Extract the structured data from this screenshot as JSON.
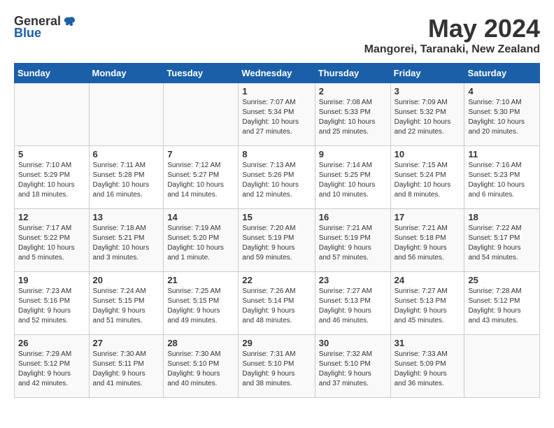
{
  "header": {
    "logo_general": "General",
    "logo_blue": "Blue",
    "month": "May 2024",
    "location": "Mangorei, Taranaki, New Zealand"
  },
  "days_of_week": [
    "Sunday",
    "Monday",
    "Tuesday",
    "Wednesday",
    "Thursday",
    "Friday",
    "Saturday"
  ],
  "weeks": [
    {
      "days": [
        {
          "num": "",
          "info": ""
        },
        {
          "num": "",
          "info": ""
        },
        {
          "num": "",
          "info": ""
        },
        {
          "num": "1",
          "info": "Sunrise: 7:07 AM\nSunset: 5:34 PM\nDaylight: 10 hours\nand 27 minutes."
        },
        {
          "num": "2",
          "info": "Sunrise: 7:08 AM\nSunset: 5:33 PM\nDaylight: 10 hours\nand 25 minutes."
        },
        {
          "num": "3",
          "info": "Sunrise: 7:09 AM\nSunset: 5:32 PM\nDaylight: 10 hours\nand 22 minutes."
        },
        {
          "num": "4",
          "info": "Sunrise: 7:10 AM\nSunset: 5:30 PM\nDaylight: 10 hours\nand 20 minutes."
        }
      ]
    },
    {
      "days": [
        {
          "num": "5",
          "info": "Sunrise: 7:10 AM\nSunset: 5:29 PM\nDaylight: 10 hours\nand 18 minutes."
        },
        {
          "num": "6",
          "info": "Sunrise: 7:11 AM\nSunset: 5:28 PM\nDaylight: 10 hours\nand 16 minutes."
        },
        {
          "num": "7",
          "info": "Sunrise: 7:12 AM\nSunset: 5:27 PM\nDaylight: 10 hours\nand 14 minutes."
        },
        {
          "num": "8",
          "info": "Sunrise: 7:13 AM\nSunset: 5:26 PM\nDaylight: 10 hours\nand 12 minutes."
        },
        {
          "num": "9",
          "info": "Sunrise: 7:14 AM\nSunset: 5:25 PM\nDaylight: 10 hours\nand 10 minutes."
        },
        {
          "num": "10",
          "info": "Sunrise: 7:15 AM\nSunset: 5:24 PM\nDaylight: 10 hours\nand 8 minutes."
        },
        {
          "num": "11",
          "info": "Sunrise: 7:16 AM\nSunset: 5:23 PM\nDaylight: 10 hours\nand 6 minutes."
        }
      ]
    },
    {
      "days": [
        {
          "num": "12",
          "info": "Sunrise: 7:17 AM\nSunset: 5:22 PM\nDaylight: 10 hours\nand 5 minutes."
        },
        {
          "num": "13",
          "info": "Sunrise: 7:18 AM\nSunset: 5:21 PM\nDaylight: 10 hours\nand 3 minutes."
        },
        {
          "num": "14",
          "info": "Sunrise: 7:19 AM\nSunset: 5:20 PM\nDaylight: 10 hours\nand 1 minute."
        },
        {
          "num": "15",
          "info": "Sunrise: 7:20 AM\nSunset: 5:19 PM\nDaylight: 9 hours\nand 59 minutes."
        },
        {
          "num": "16",
          "info": "Sunrise: 7:21 AM\nSunset: 5:19 PM\nDaylight: 9 hours\nand 57 minutes."
        },
        {
          "num": "17",
          "info": "Sunrise: 7:21 AM\nSunset: 5:18 PM\nDaylight: 9 hours\nand 56 minutes."
        },
        {
          "num": "18",
          "info": "Sunrise: 7:22 AM\nSunset: 5:17 PM\nDaylight: 9 hours\nand 54 minutes."
        }
      ]
    },
    {
      "days": [
        {
          "num": "19",
          "info": "Sunrise: 7:23 AM\nSunset: 5:16 PM\nDaylight: 9 hours\nand 52 minutes."
        },
        {
          "num": "20",
          "info": "Sunrise: 7:24 AM\nSunset: 5:15 PM\nDaylight: 9 hours\nand 51 minutes."
        },
        {
          "num": "21",
          "info": "Sunrise: 7:25 AM\nSunset: 5:15 PM\nDaylight: 9 hours\nand 49 minutes."
        },
        {
          "num": "22",
          "info": "Sunrise: 7:26 AM\nSunset: 5:14 PM\nDaylight: 9 hours\nand 48 minutes."
        },
        {
          "num": "23",
          "info": "Sunrise: 7:27 AM\nSunset: 5:13 PM\nDaylight: 9 hours\nand 46 minutes."
        },
        {
          "num": "24",
          "info": "Sunrise: 7:27 AM\nSunset: 5:13 PM\nDaylight: 9 hours\nand 45 minutes."
        },
        {
          "num": "25",
          "info": "Sunrise: 7:28 AM\nSunset: 5:12 PM\nDaylight: 9 hours\nand 43 minutes."
        }
      ]
    },
    {
      "days": [
        {
          "num": "26",
          "info": "Sunrise: 7:29 AM\nSunset: 5:12 PM\nDaylight: 9 hours\nand 42 minutes."
        },
        {
          "num": "27",
          "info": "Sunrise: 7:30 AM\nSunset: 5:11 PM\nDaylight: 9 hours\nand 41 minutes."
        },
        {
          "num": "28",
          "info": "Sunrise: 7:30 AM\nSunset: 5:10 PM\nDaylight: 9 hours\nand 40 minutes."
        },
        {
          "num": "29",
          "info": "Sunrise: 7:31 AM\nSunset: 5:10 PM\nDaylight: 9 hours\nand 38 minutes."
        },
        {
          "num": "30",
          "info": "Sunrise: 7:32 AM\nSunset: 5:10 PM\nDaylight: 9 hours\nand 37 minutes."
        },
        {
          "num": "31",
          "info": "Sunrise: 7:33 AM\nSunset: 5:09 PM\nDaylight: 9 hours\nand 36 minutes."
        },
        {
          "num": "",
          "info": ""
        }
      ]
    }
  ]
}
